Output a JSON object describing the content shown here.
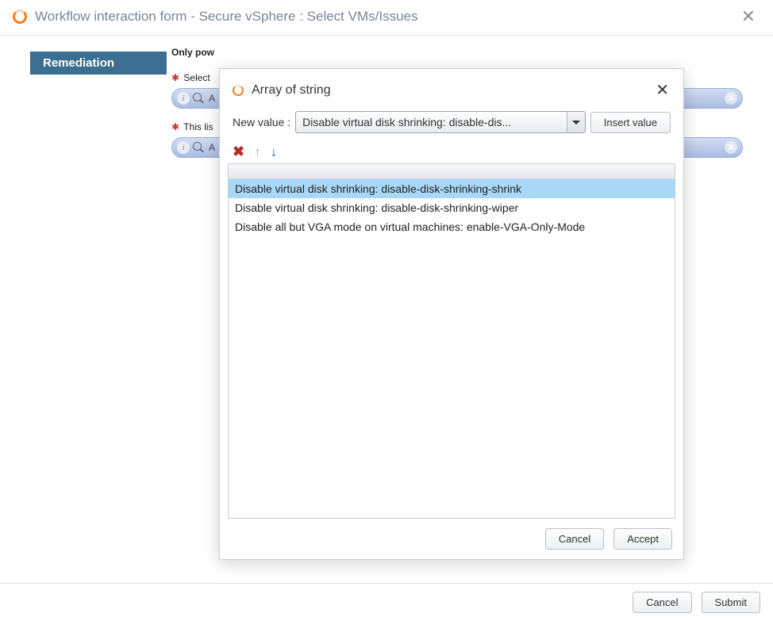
{
  "titlebar": {
    "title": "Workflow interaction form - Secure vSphere : Select VMs/Issues"
  },
  "sidebar": {
    "active": "Remediation"
  },
  "content": {
    "note": "Only pow",
    "field1_label": "Select",
    "field1_pill_text": "A",
    "field2_label": "This lis",
    "field2_pill_text": "A"
  },
  "footer": {
    "cancel": "Cancel",
    "submit": "Submit"
  },
  "modal": {
    "title": "Array of string",
    "new_value_label": "New value :",
    "combo_text": "Disable virtual disk shrinking: disable-dis...",
    "insert_label": "Insert value",
    "items": [
      "Disable virtual disk shrinking: disable-disk-shrinking-shrink",
      "Disable virtual disk shrinking: disable-disk-shrinking-wiper",
      "Disable all but VGA mode on virtual machines: enable-VGA-Only-Mode"
    ],
    "selected_index": 0,
    "cancel": "Cancel",
    "accept": "Accept"
  }
}
